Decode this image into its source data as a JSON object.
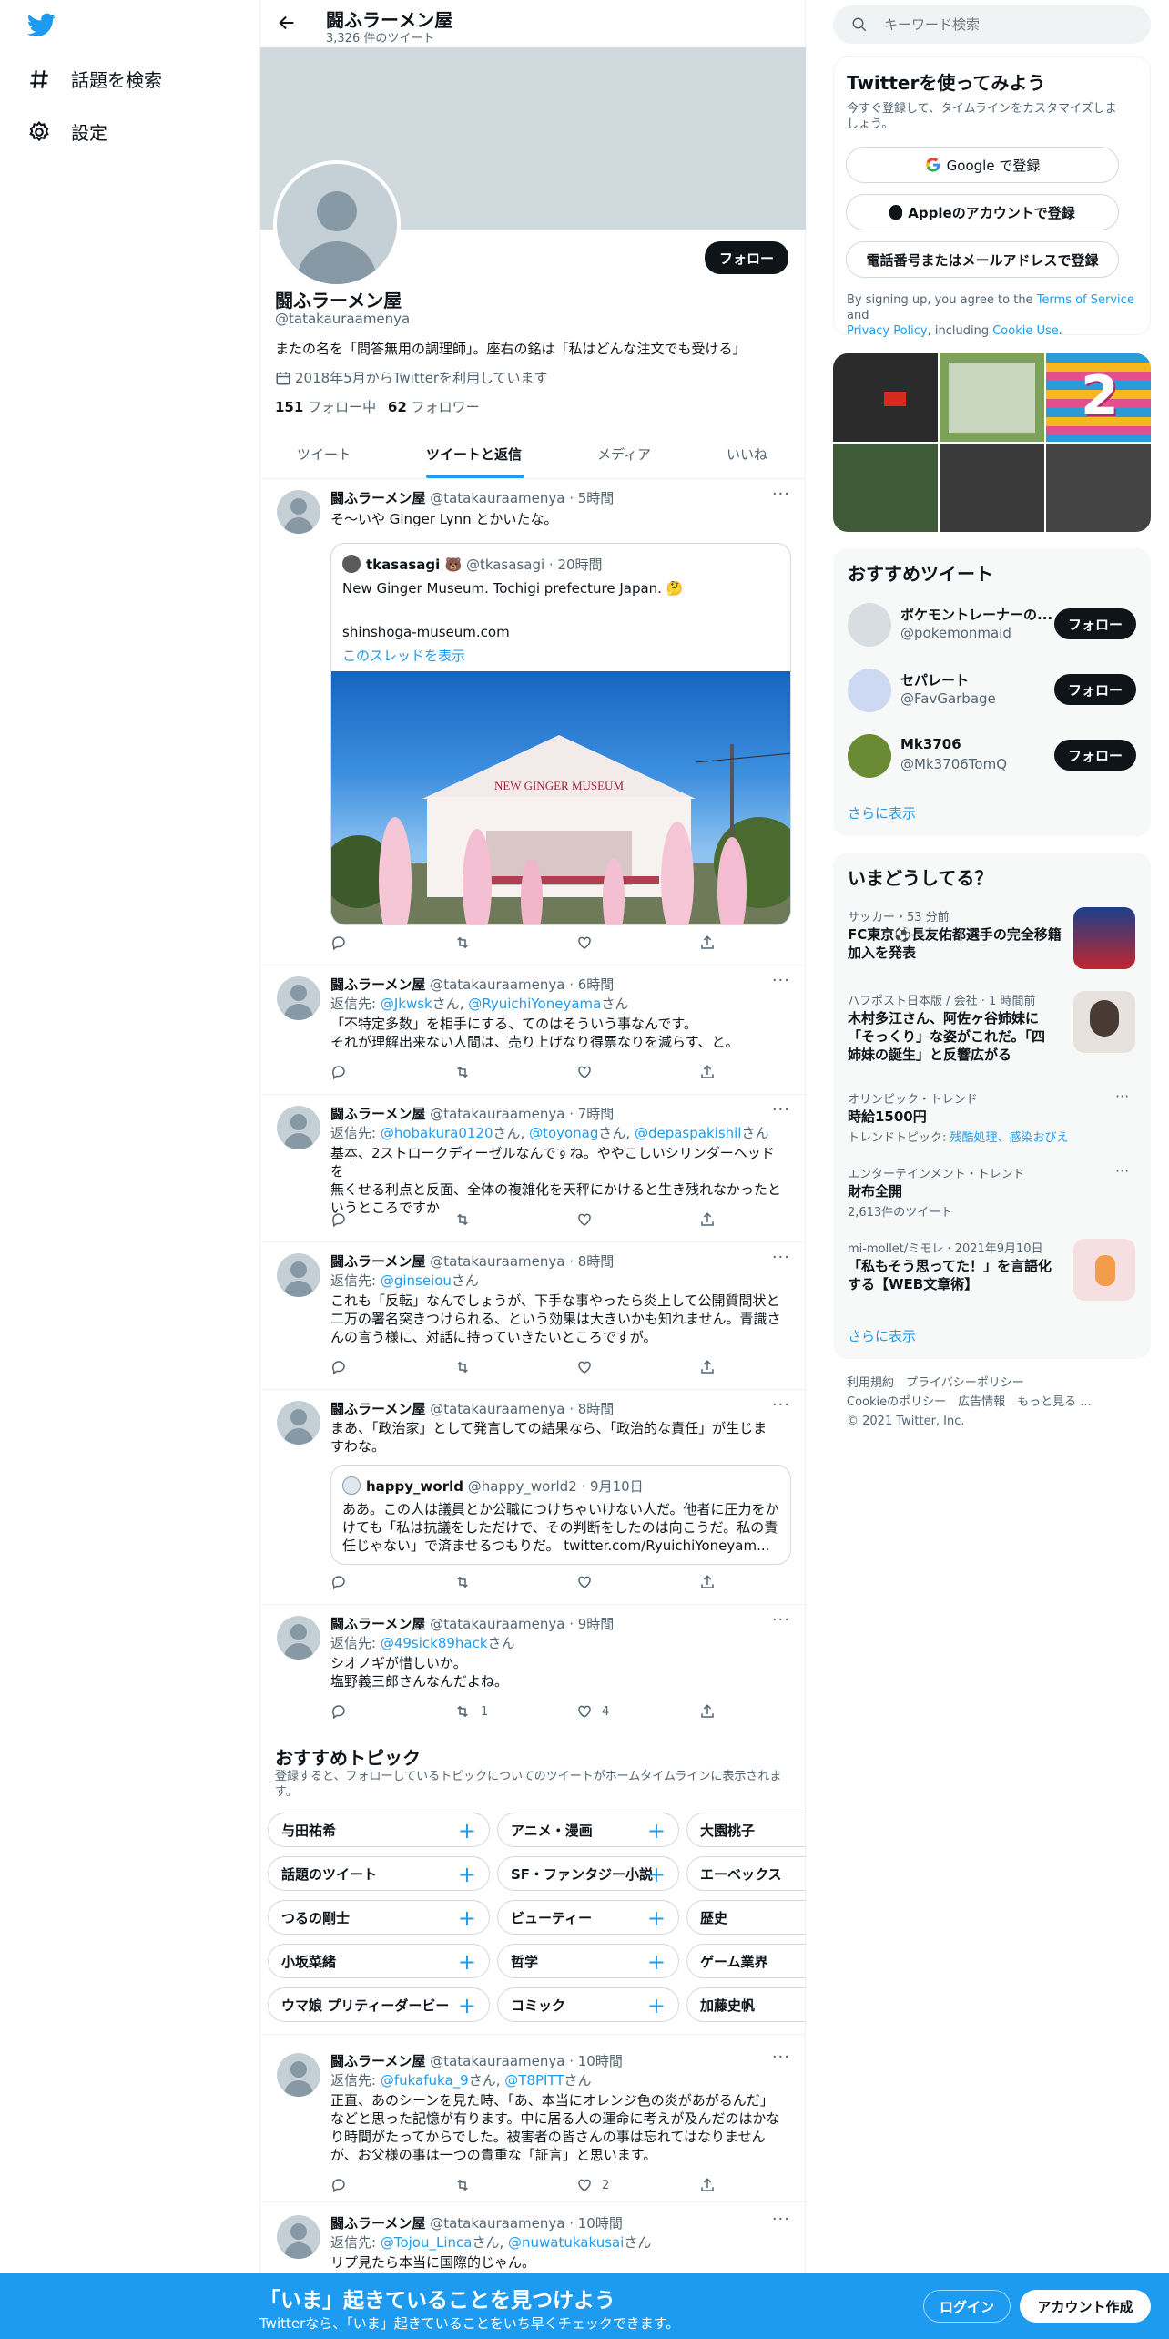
{
  "nav": {
    "explore": "話題を検索",
    "settings": "設定"
  },
  "header": {
    "title": "闘ふラーメン屋",
    "tweet_count": "3,326 件のツイート"
  },
  "profile": {
    "follow_label": "フォロー",
    "name": "闘ふラーメン屋",
    "handle": "@tatakauraamenya",
    "bio": "またの名を「問答無用の調理師」。座右の銘は「私はどんな注文でも受ける」",
    "joined": "2018年5月からTwitterを利用しています",
    "following_count": "151",
    "following_label": "フォロー中",
    "followers_count": "62",
    "followers_label": "フォロワー"
  },
  "tabs": [
    "ツイート",
    "ツイートと返信",
    "メディア",
    "いいね"
  ],
  "tweets": [
    {
      "name": "闘ふラーメン屋",
      "meta": "@tatakauraamenya · 5時間",
      "lines": [
        "そ～いや Ginger Lynn とかいたな。"
      ],
      "quote": {
        "name": "tkasasagi 🐻",
        "meta": "@tkasasagi · 20時間",
        "text": "New Ginger Museum. Tochigi prefecture Japan. 🤔",
        "url": "shinshoga-museum.com",
        "thread": "このスレッドを表示",
        "sign": "NEW GINGER MUSEUM"
      }
    },
    {
      "name": "闘ふラーメン屋",
      "meta": "@tatakauraamenya · 6時間",
      "reply_prefix": "返信先: ",
      "reply_users": [
        "@Jkwsk",
        "@RyuichiYoneyama"
      ],
      "honorific": "さん",
      "lines": [
        "「不特定多数」を相手にする、てのはそういう事なんです。",
        "それが理解出来ない人間は、売り上げなり得票なりを減らす、と。"
      ]
    },
    {
      "name": "闘ふラーメン屋",
      "meta": "@tatakauraamenya · 7時間",
      "reply_prefix": "返信先: ",
      "reply_users": [
        "@hobakura0120",
        "@toyonag",
        "@depaspakishil"
      ],
      "honorific": "さん",
      "lines": [
        "基本、2ストロークディーゼルなんですね。ややこしいシリンダーヘッドを",
        "無くせる利点と反面、全体の複雑化を天秤にかけると生き残れなかったと",
        "いうところですか"
      ]
    },
    {
      "name": "闘ふラーメン屋",
      "meta": "@tatakauraamenya · 8時間",
      "reply_prefix": "返信先: ",
      "reply_users": [
        "@ginseiou"
      ],
      "honorific": "さん",
      "lines": [
        "これも「反転」なんでしょうが、下手な事やったら炎上して公開質問状と",
        "二万の署名突きつけられる、という効果は大きいかも知れません。青識さ",
        "んの言う様に、対話に持っていきたいところですが。"
      ]
    },
    {
      "name": "闘ふラーメン屋",
      "meta": "@tatakauraamenya · 8時間",
      "lines": [
        "まあ、「政治家」として発言しての結果なら、「政治的な責任」が生じま",
        "すわな。"
      ],
      "quote": {
        "name": "happy_world",
        "meta": "@happy_world2 · 9月10日",
        "lines": [
          "ああ。この人は議員とか公職につけちゃいけない人だ。他者に圧力をか",
          "けても「私は抗議をしただけで、その判断をしたのは向こうだ。私の責",
          "任じゃない」で済ませるつもりだ。 twitter.com/RyuichiYoneyam..."
        ]
      }
    },
    {
      "name": "闘ふラーメン屋",
      "meta": "@tatakauraamenya · 9時間",
      "reply_prefix": "返信先: ",
      "reply_users": [
        "@49sick89hack"
      ],
      "honorific": "さん",
      "lines": [
        "シオノギが惜しいか。",
        "塩野義三郎さんなんだよね。"
      ],
      "retweets": "1",
      "likes": "4"
    },
    {
      "name": "闘ふラーメン屋",
      "meta": "@tatakauraamenya · 10時間",
      "reply_prefix": "返信先: ",
      "reply_users": [
        "@fukafuka_9",
        "@T8PITT"
      ],
      "honorific": "さん",
      "lines": [
        "正直、あのシーンを見た時、「あ、本当にオレンジ色の炎があがるんだ」",
        "などと思った記憶が有ります。中に居る人の運命に考えが及んだのはかな",
        "り時間がたってからでした。被害者の皆さんの事は忘れてはなりません",
        "が、お父様の事は一つの貴重な「証言」と思います。"
      ],
      "likes": "2"
    },
    {
      "name": "闘ふラーメン屋",
      "meta": "@tatakauraamenya · 10時間",
      "reply_prefix": "返信先: ",
      "reply_users": [
        "@Tojou_Linca",
        "@nuwatukakusai"
      ],
      "honorific": "さん",
      "lines": [
        "リプ見たら本当に国際的じゃん。"
      ]
    }
  ],
  "topics": {
    "title": "おすすめトピック",
    "subtitle": [
      "登録すると、フォローしているトピックについてのツイートがホームタイムラインに表示されま",
      "す。"
    ],
    "rows": [
      [
        "与田祐希",
        "アニメ・漫画",
        "大園桃子"
      ],
      [
        "話題のツイート",
        "SF・ファンタジー小説",
        "エーベックス"
      ],
      [
        "つるの剛士",
        "ビューティー",
        "歴史"
      ],
      [
        "小坂菜緒",
        "哲学",
        "ゲーム業界"
      ],
      [
        "ウマ娘 プリティーダービー",
        "コミック",
        "加藤史帆"
      ]
    ]
  },
  "search": {
    "placeholder": "キーワード検索"
  },
  "signup": {
    "title": "Twitterを使ってみよう",
    "subtitle": [
      "今すぐ登録して、タイムラインをカスタマイズしま",
      "しょう。"
    ],
    "google": "Google で登録",
    "apple": "Appleのアカウントで登録",
    "phone": "電話番号またはメールアドレスで登録",
    "legal_1": "By signing up, you agree to the ",
    "terms": "Terms of Service",
    "legal_2": " and",
    "privacy": "Privacy Policy",
    "legal_3": ", including ",
    "cookie": "Cookie Use",
    "legal_4": "."
  },
  "media_number": "2",
  "recommended": {
    "title": "おすすめツイート",
    "follow_label": "フォロー",
    "more": "さらに表示",
    "accounts": [
      {
        "name": "ポケモントレーナーの...",
        "handle": "@pokemonmaid"
      },
      {
        "name": "セパレート",
        "handle": "@FavGarbage"
      },
      {
        "name": "Mk3706",
        "handle": "@Mk3706TomQ"
      }
    ]
  },
  "trends": {
    "title": "いまどうしてる？",
    "more": "さらに表示",
    "items": [
      {
        "cat": "サッカー・53 分前",
        "title": [
          "FC東京⚽長友佑都選手の完全移籍",
          "加入を発表"
        ]
      },
      {
        "cat": "ハフポスト日本版 / 会社 · 1 時間前",
        "title": [
          "木村多江さん、阿佐ヶ谷姉妹に",
          "「そっくり」な姿がこれだ。「四",
          "姉妹の誕生」と反響広がる"
        ]
      },
      {
        "cat": "オリンピック・トレンド",
        "title": [
          "時給1500円"
        ],
        "sub_prefix": "トレンドトピック: ",
        "sub": "残酷処理、感染おびえ"
      },
      {
        "cat": "エンターテインメント・トレンド",
        "title": [
          "財布全開"
        ],
        "sub_gray": "2,613件のツイート"
      },
      {
        "cat": "mi-mollet/ミモレ · 2021年9月10日",
        "title": [
          "「私もそう思ってた！」を言語化",
          "する【WEB文章術】"
        ]
      }
    ]
  },
  "footer": {
    "line1": [
      "利用規約",
      "プライバシーポリシー"
    ],
    "line2": [
      "Cookieのポリシー",
      "広告情報",
      "もっと見る ..."
    ],
    "copyright": "© 2021 Twitter, Inc."
  },
  "banner": {
    "title": "「いま」起きていることを見つけよう",
    "subtitle": "Twitterなら、「いま」起きていることをいち早くチェックできます。",
    "login": "ログイン",
    "signup": "アカウント作成"
  },
  "colors": {
    "accent": "#1d9bf0",
    "banner": "#1d9bf0",
    "text": "#0f1419",
    "secondary": "#536471"
  }
}
